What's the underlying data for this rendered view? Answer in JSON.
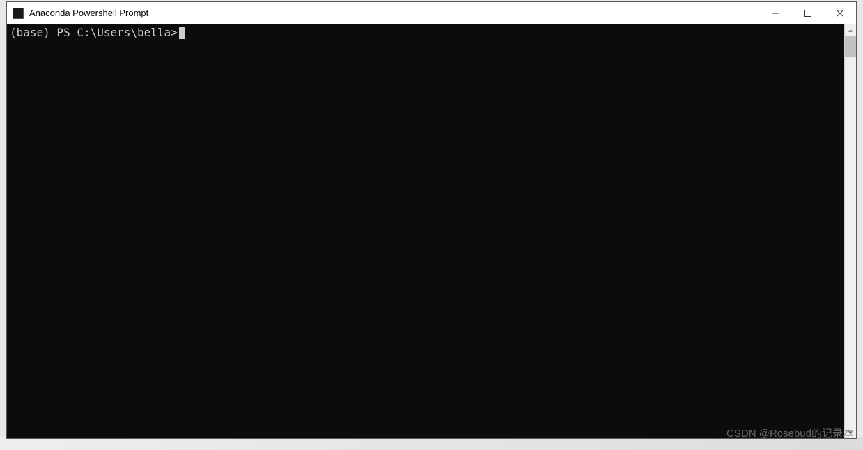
{
  "window": {
    "title": "Anaconda Powershell Prompt"
  },
  "terminal": {
    "prompt": "(base) PS C:\\Users\\bella>"
  },
  "watermark": "CSDN @Rosebud的记录本"
}
